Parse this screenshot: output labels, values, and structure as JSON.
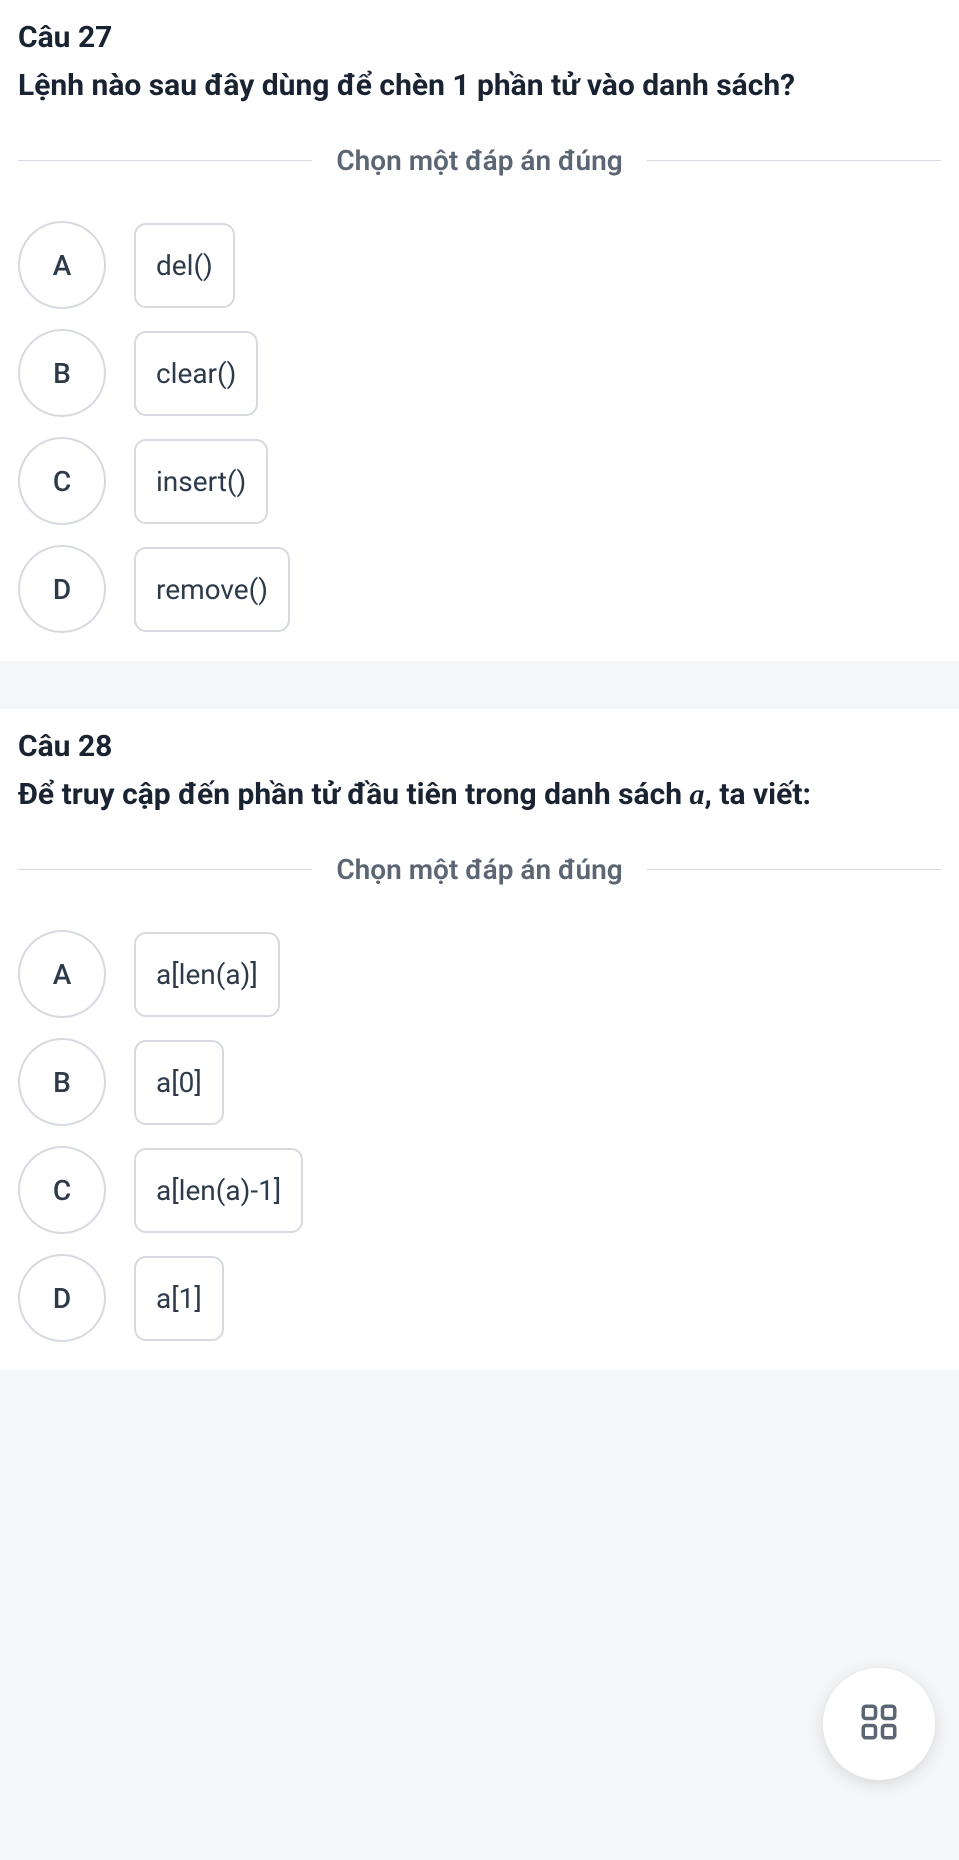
{
  "questions": [
    {
      "title": "Câu 27",
      "text_parts": [
        "Lệnh nào sau đây dùng để chèn 1 phần tử vào danh sách?"
      ],
      "instruction": "Chọn một đáp án đúng",
      "options": [
        {
          "letter": "A",
          "value": "del()"
        },
        {
          "letter": "B",
          "value": "clear()"
        },
        {
          "letter": "C",
          "value": "insert()"
        },
        {
          "letter": "D",
          "value": "remove()"
        }
      ]
    },
    {
      "title": "Câu 28",
      "text_parts": [
        "Để truy cập đến phần tử đầu tiên trong danh sách ",
        "a",
        ", ta viết:"
      ],
      "instruction": "Chọn một đáp án đúng",
      "options": [
        {
          "letter": "A",
          "value": "a[len(a)]"
        },
        {
          "letter": "B",
          "value": "a[0]"
        },
        {
          "letter": "C",
          "value": "a[len(a)-1]"
        },
        {
          "letter": "D",
          "value": "a[1]"
        }
      ]
    }
  ]
}
